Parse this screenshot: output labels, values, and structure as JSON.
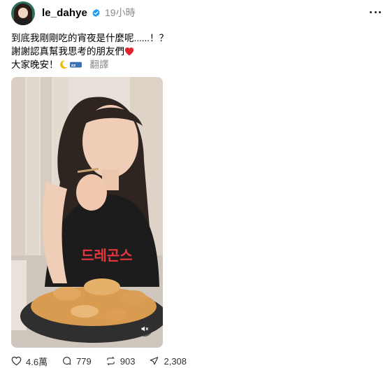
{
  "post": {
    "username": "le_dahye",
    "timestamp": "19小時",
    "lines": {
      "line1": "到底我剛剛吃的宵夜是什麼呢......！？",
      "line2": "謝謝認真幫我思考的朋友們",
      "line3": "大家晚安！"
    },
    "translate_label": "翻譯",
    "video_shirt_text": "드레곤스"
  },
  "actions": {
    "likes": "4.6萬",
    "replies": "779",
    "reposts": "903",
    "shares": "2,308"
  },
  "icons": {
    "avatar": "avatar",
    "verified": "verified-badge-icon",
    "more": "more-options-icon",
    "heart": "red-heart-emoji",
    "moon": "crescent-moon-emoji",
    "sleep": "zzz-sleeping-emoji",
    "mute": "speaker-muted-icon",
    "like": "heart-outline-icon",
    "reply": "comment-icon",
    "repost": "repost-icon",
    "share": "send-icon"
  },
  "colors": {
    "verified": "#1d9bf0",
    "heart": "#e0262d",
    "muted_text": "#8a8a8a"
  }
}
